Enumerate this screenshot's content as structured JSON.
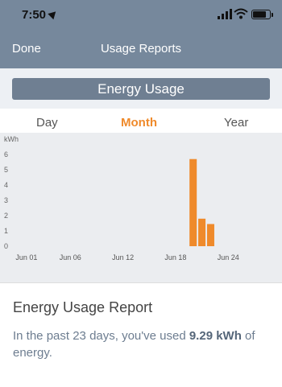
{
  "status_bar": {
    "time": "7:50",
    "location_icon": "location-arrow-icon",
    "signal_icon": "cellular-signal-icon",
    "wifi_icon": "wifi-icon",
    "battery_icon": "battery-icon"
  },
  "nav": {
    "done_label": "Done",
    "title": "Usage Reports"
  },
  "banner": {
    "label": "Energy Usage"
  },
  "tabs": [
    {
      "label": "Day",
      "active": false
    },
    {
      "label": "Month",
      "active": true
    },
    {
      "label": "Year",
      "active": false
    }
  ],
  "colors": {
    "header": "#76889c",
    "accent": "#ef8a2b",
    "banner": "#6f7f92",
    "chart_bg": "#ebedf0"
  },
  "chart_data": {
    "type": "bar",
    "ylabel": "kWh",
    "ylim": [
      0,
      6
    ],
    "yticks": [
      0,
      1,
      2,
      3,
      4,
      5,
      6
    ],
    "xticks": [
      "Jun 01",
      "Jun 06",
      "Jun 12",
      "Jun 18",
      "Jun 24"
    ],
    "xtick_days": [
      1,
      6,
      12,
      18,
      24
    ],
    "x_range_days": [
      0,
      26
    ],
    "bars": [
      {
        "day": 20,
        "value": 5.7
      },
      {
        "day": 21,
        "value": 1.8
      },
      {
        "day": 22,
        "value": 1.45
      }
    ],
    "bar_color": "#ef8a2b",
    "grid": false
  },
  "report": {
    "title": "Energy Usage Report",
    "text_before": "In the past 23 days, you've used ",
    "amount": "9.29 kWh",
    "text_after": " of energy."
  }
}
